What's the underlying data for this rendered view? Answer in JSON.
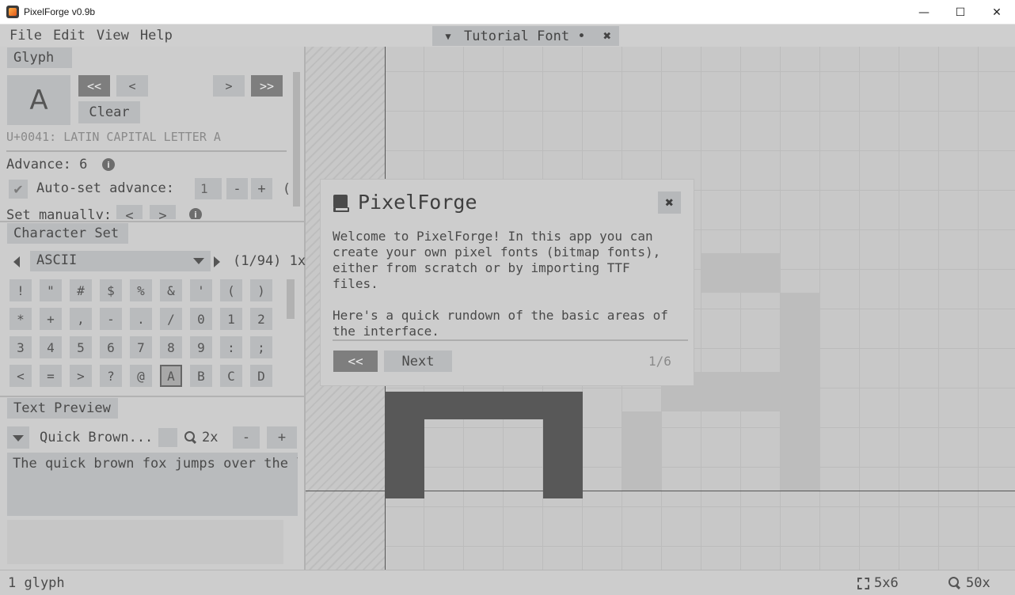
{
  "window": {
    "title": "PixelForge v0.9b",
    "controls": {
      "minimize": "—",
      "maximize": "☐",
      "close": "✕"
    }
  },
  "menu": {
    "items": [
      "File",
      "Edit",
      "View",
      "Help"
    ]
  },
  "document_tab": {
    "name": "Tutorial Font",
    "dirty_marker": "•",
    "close": "✖",
    "dropdown_icon": "triangle-down-icon"
  },
  "glyph_panel": {
    "tab": "Glyph",
    "preview_char": "A",
    "nav": {
      "first": "<<",
      "prev": "<",
      "next": ">",
      "last": ">>"
    },
    "clear_label": "Clear",
    "unicode_name": "U+0041: LATIN CAPITAL LETTER A",
    "advance_label": "Advance: 6",
    "auto_set_label": "Auto-set advance:",
    "auto_set_checked": true,
    "auto_set_value": "1",
    "minus": "-",
    "plus": "+",
    "set_manually_label": "Set manually:",
    "manual_prev": "<",
    "manual_next": ">"
  },
  "charset_panel": {
    "tab": "Character Set",
    "selected_set": "ASCII",
    "count": "(1/94) 1x",
    "characters": [
      "!",
      "\"",
      "#",
      "$",
      "%",
      "&",
      "'",
      "(",
      ")",
      "*",
      "+",
      ",",
      "-",
      ".",
      "/",
      "0",
      "1",
      "2",
      "3",
      "4",
      "5",
      "6",
      "7",
      "8",
      "9",
      ":",
      ";",
      "<",
      "=",
      ">",
      "?",
      "@",
      "A",
      "B",
      "C",
      "D"
    ],
    "selected_char": "A"
  },
  "text_preview": {
    "tab": "Text Preview",
    "sample_name": "Quick Brown...",
    "zoom": "2x",
    "minus": "-",
    "plus": "+",
    "text": "The quick brown fox jumps over the lazy dog"
  },
  "statusbar": {
    "glyph_count": "1 glyph",
    "canvas_size": "5x6",
    "zoom": "50x"
  },
  "dialog": {
    "title": "PixelForge",
    "close": "✖",
    "paragraphs": [
      "Welcome to PixelForge! In this app you can create your own pixel fonts (bitmap fonts), either from scratch or by importing TTF files.",
      "Here's a quick rundown of the basic areas of the interface."
    ],
    "prev_label": "<<",
    "next_label": "Next",
    "page": "1/6"
  },
  "colors": {
    "background": "#c9c9c9",
    "panel": "#cdcdcd",
    "button": "#b9bbbd",
    "button_dark": "#7e7e7e",
    "pixel_on": "#585858",
    "text": "#4a4a4a"
  }
}
